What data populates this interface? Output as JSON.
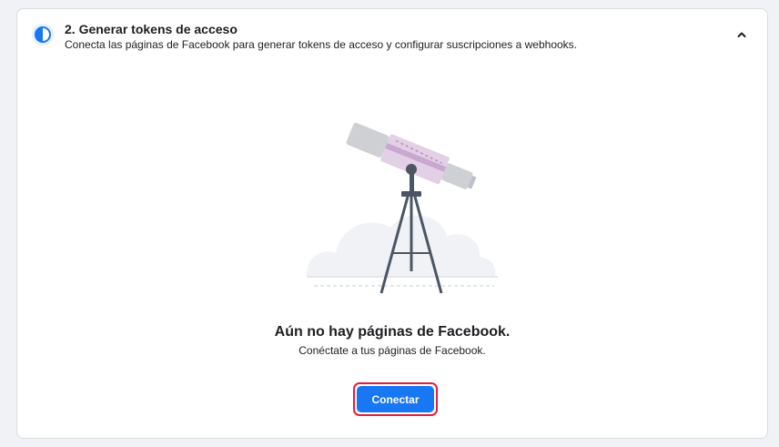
{
  "section": {
    "step_icon": "half-circle-icon",
    "title": "2. Generar tokens de acceso",
    "subtitle": "Conecta las páginas de Facebook para generar tokens de acceso y configurar suscripciones a webhooks.",
    "collapse_icon": "chevron-up-icon"
  },
  "empty_state": {
    "illustration": "telescope-illustration",
    "title": "Aún no hay páginas de Facebook.",
    "description": "Conéctate a tus páginas de Facebook.",
    "button_label": "Conectar"
  },
  "colors": {
    "accent": "#1877f2",
    "focus_ring": "#e41e3f",
    "card_bg": "#ffffff",
    "page_bg": "#f0f2f5"
  }
}
